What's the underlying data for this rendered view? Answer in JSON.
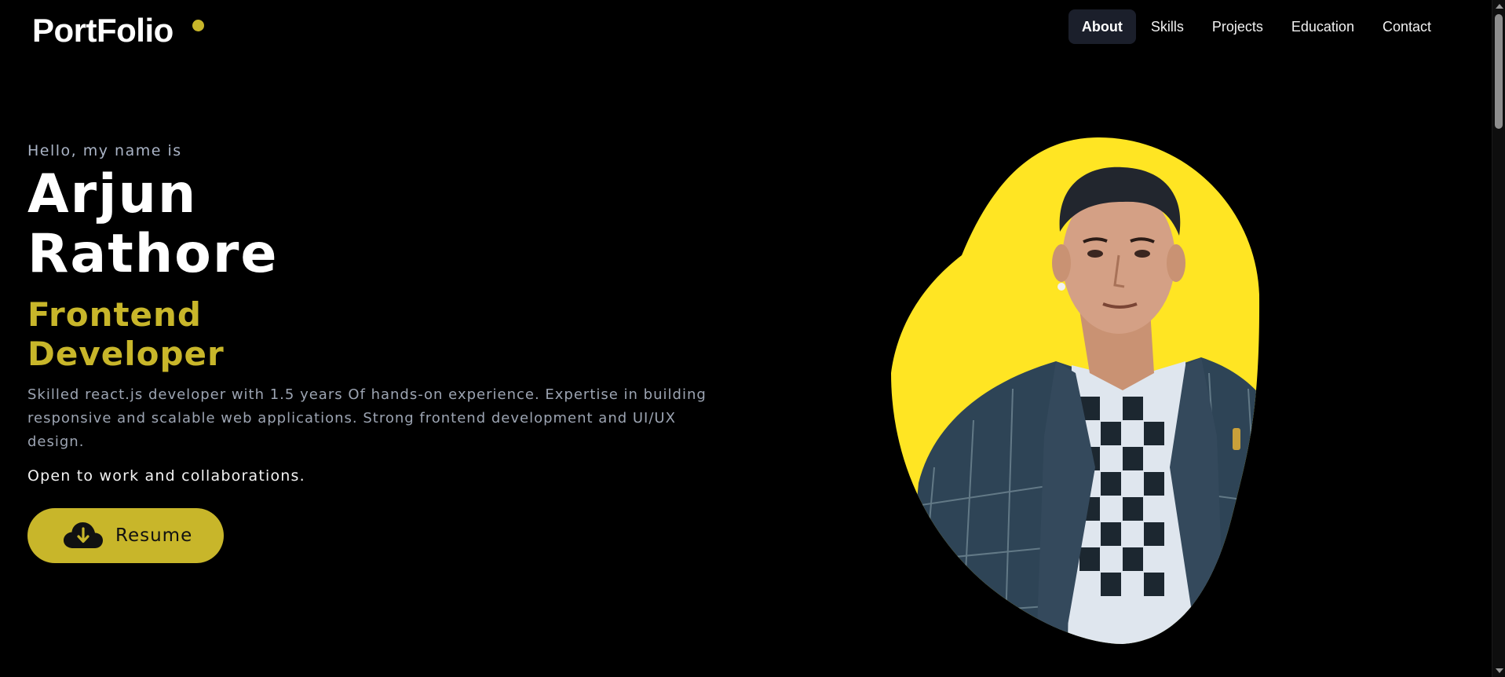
{
  "header": {
    "logo": "PortFolio",
    "nav": [
      {
        "label": "About",
        "active": true
      },
      {
        "label": "Skills",
        "active": false
      },
      {
        "label": "Projects",
        "active": false
      },
      {
        "label": "Education",
        "active": false
      },
      {
        "label": "Contact",
        "active": false
      }
    ]
  },
  "hero": {
    "greeting": "Hello, my name is",
    "name": "Arjun Rathore",
    "role": "Frontend Developer",
    "description": "Skilled react.js developer with 1.5 years Of hands-on experience. Expertise in building responsive and scalable web applications. Strong frontend development and UI/UX design.",
    "availability": "Open to work and collaborations.",
    "resume_label": "Resume",
    "resume_icon": "cloud-download-icon"
  },
  "colors": {
    "background": "#000000",
    "accent": "#c8b62a",
    "portrait_blob": "#ffe523",
    "muted_text": "#9ca4b2"
  }
}
